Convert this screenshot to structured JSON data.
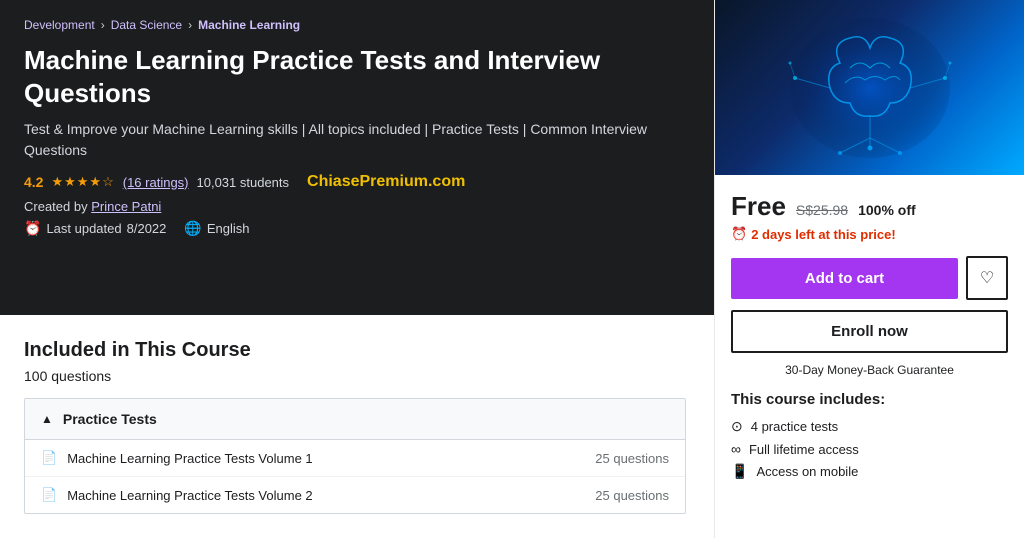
{
  "breadcrumb": {
    "items": [
      {
        "label": "Development",
        "active": false
      },
      {
        "label": "Data Science",
        "active": false
      },
      {
        "label": "Machine Learning",
        "active": true
      }
    ],
    "separator": "›"
  },
  "course": {
    "title": "Machine Learning Practice Tests and Interview Questions",
    "subtitle": "Test & Improve your Machine Learning skills | All topics included | Practice Tests | Common Interview Questions",
    "rating": "4.2",
    "stars": "★★★★☆",
    "ratings_count": "(16 ratings)",
    "students": "10,031 students",
    "chiase": "ChiasePremium.com",
    "creator_label": "Created by",
    "creator_name": "Prince Patni",
    "last_updated_label": "Last updated",
    "last_updated": "8/2022",
    "language": "English"
  },
  "included": {
    "section_title": "Included in This Course",
    "questions_count": "100 questions",
    "section_name": "Practice Tests",
    "items": [
      {
        "name": "Machine Learning Practice Tests Volume 1",
        "count": "25 questions"
      },
      {
        "name": "Machine Learning Practice Tests Volume 2",
        "count": "25 questions"
      }
    ]
  },
  "pricing": {
    "free_label": "Free",
    "original_price": "S$25.98",
    "discount": "100% off",
    "urgency": "2 days left at this price!",
    "add_to_cart": "Add to cart",
    "enroll_now": "Enroll now",
    "money_back": "30-Day Money-Back Guarantee"
  },
  "includes_list": {
    "title": "This course includes:",
    "items": [
      {
        "icon": "⊙",
        "text": "4 practice tests"
      },
      {
        "icon": "∞",
        "text": "Full lifetime access"
      },
      {
        "icon": "□",
        "text": "Access on mobile"
      }
    ]
  }
}
